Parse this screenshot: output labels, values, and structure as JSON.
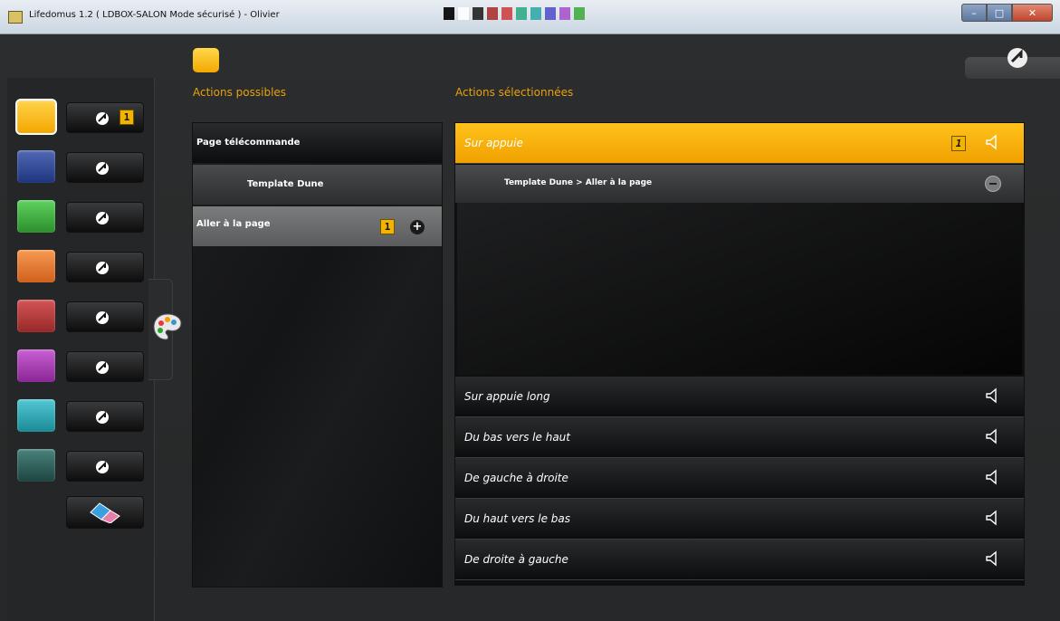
{
  "window": {
    "title": "Lifedomus 1.2 ( LDBOX-SALON Mode sécurisé ) - Olivier",
    "controls": [
      "minimize",
      "maximize",
      "close"
    ]
  },
  "colors": {
    "accent": "#e9a10d",
    "swatches": [
      "#f9b722",
      "#2e4a9c",
      "#3aa83a",
      "#e77a2c",
      "#b83a3a",
      "#a53bb1",
      "#2aa9b6",
      "#2e5e58"
    ]
  },
  "sidebar": {
    "rows": [
      {
        "color": "#f9b722",
        "selected": true,
        "badge": "1"
      },
      {
        "color": "#2e4a9c",
        "selected": false,
        "badge": ""
      },
      {
        "color": "#3aa83a",
        "selected": false,
        "badge": ""
      },
      {
        "color": "#e77a2c",
        "selected": false,
        "badge": ""
      },
      {
        "color": "#b83a3a",
        "selected": false,
        "badge": ""
      },
      {
        "color": "#a53bb1",
        "selected": false,
        "badge": ""
      },
      {
        "color": "#2aa9b6",
        "selected": false,
        "badge": ""
      },
      {
        "color": "#2e5e58",
        "selected": false,
        "badge": ""
      }
    ],
    "eraser_icon": "eraser-icon",
    "palette_icon": "palette-icon"
  },
  "left": {
    "heading": "Actions possibles",
    "items": [
      {
        "label": "Page télécommande"
      },
      {
        "label": "Template Dune"
      },
      {
        "label": "Aller à la page",
        "badge": "1"
      }
    ]
  },
  "right": {
    "heading": "Actions sélectionnées",
    "events": [
      {
        "label": "Sur appuie",
        "badge": "1",
        "active": true
      },
      {
        "label": "Sur appuie long"
      },
      {
        "label": "Du bas vers le haut"
      },
      {
        "label": "De gauche à droite"
      },
      {
        "label": "Du haut vers le bas"
      },
      {
        "label": "De droite à gauche"
      }
    ],
    "selected_action": "Template Dune > Aller à la page"
  }
}
